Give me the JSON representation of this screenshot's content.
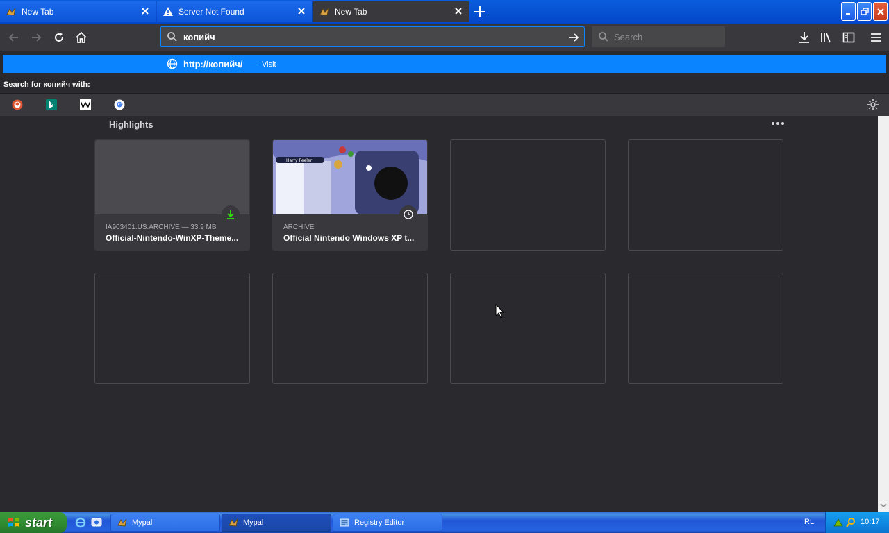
{
  "tabs": [
    {
      "title": "New Tab",
      "icon": "mypal-icon",
      "active": false
    },
    {
      "title": "Server Not Found",
      "icon": "warning-icon",
      "active": false
    },
    {
      "title": "New Tab",
      "icon": "mypal-icon",
      "active": true
    }
  ],
  "urlbar": {
    "value": "копийч",
    "search_placeholder": "Search"
  },
  "suggestion": {
    "url": "http://копийч/",
    "separator": "—",
    "action": "Visit"
  },
  "search_with": "Search for копийч with:",
  "engines": [
    "duckduckgo-icon",
    "bing-icon",
    "wikipedia-icon",
    "google-icon"
  ],
  "highlights": {
    "title": "Highlights",
    "cards": [
      {
        "meta": "IA903401.US.ARCHIVE — 33.9 MB",
        "name": "Official-Nintendo-WinXP-Theme...",
        "badge": "download-icon"
      },
      {
        "meta": "ARCHIVE",
        "name": "Official Nintendo Windows XP t...",
        "badge": "clock-icon",
        "thumb_caption": "Harry Peeler"
      }
    ],
    "empty_slots": 6
  },
  "taskbar": {
    "start_label": "start",
    "tasks": [
      {
        "label": "Mypal",
        "pressed": false
      },
      {
        "label": "Mypal",
        "pressed": true
      },
      {
        "label": "Registry Editor",
        "pressed": false
      }
    ],
    "language": "RL",
    "clock": "10:17"
  },
  "colors": {
    "accent": "#0a84ff",
    "toolbar": "#38383d",
    "content_bg": "#2a2a2e",
    "download_green": "#30e60b"
  }
}
